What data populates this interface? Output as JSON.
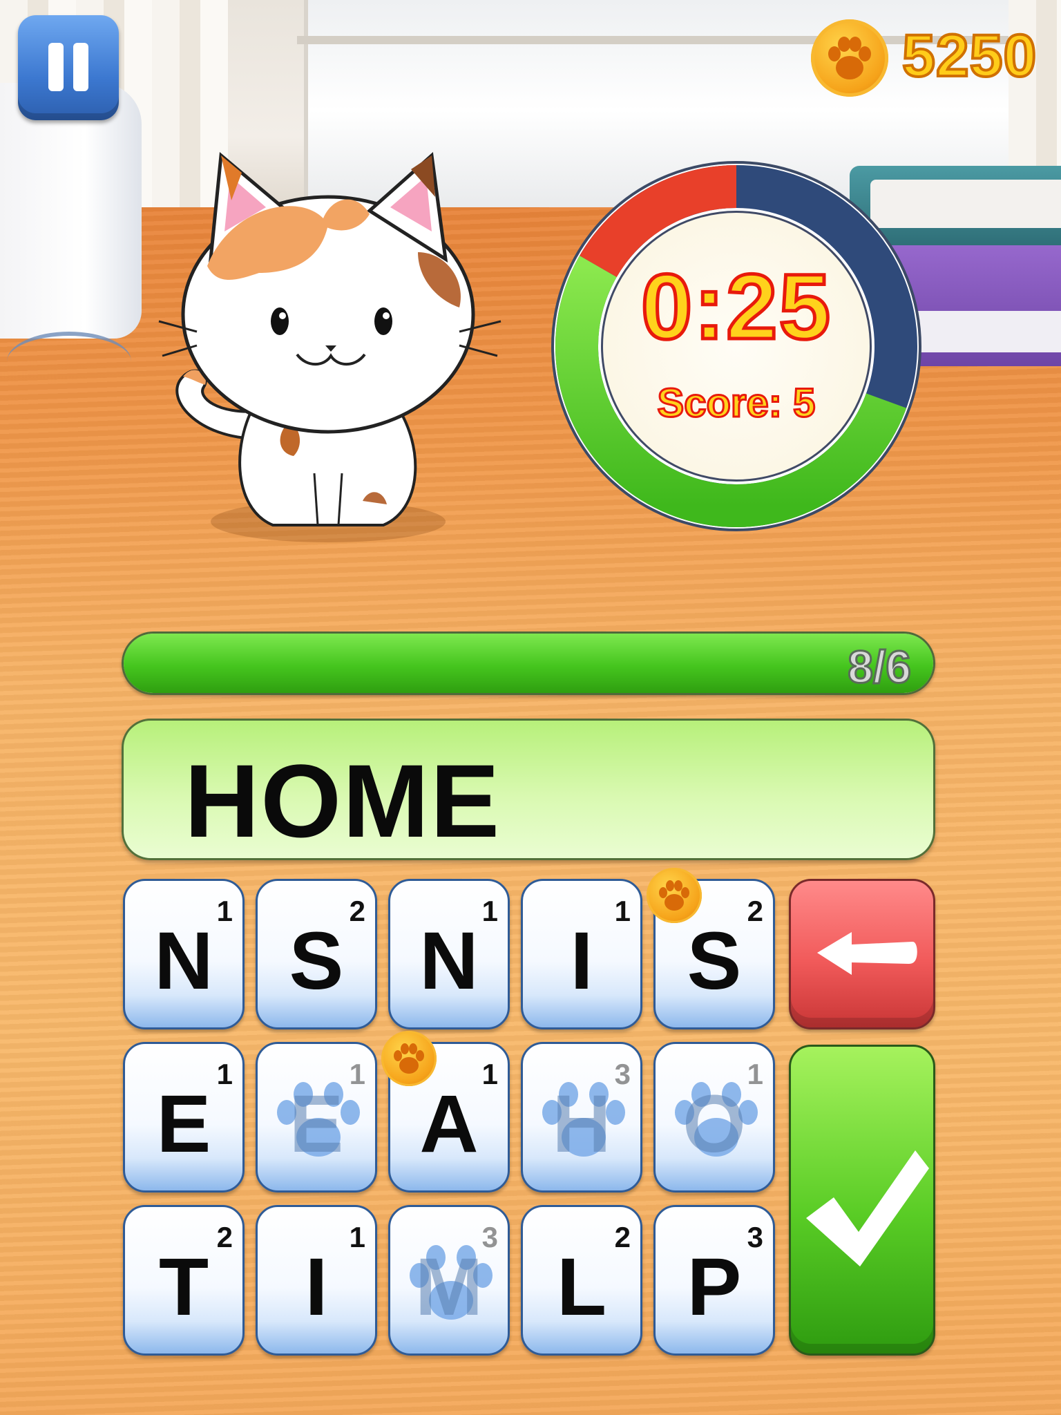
{
  "hud": {
    "coins": "5250",
    "pause_icon": "pause-icon",
    "coin_icon": "paw-coin-icon"
  },
  "timer": {
    "time": "0:25",
    "score": "Score: 5",
    "remaining_fraction": 0.58,
    "colors": {
      "remaining": "#56c82c",
      "elapsed_red": "#e8402a",
      "track": "#2f4a7a"
    }
  },
  "progress": {
    "label": "8/6",
    "fill_fraction": 1.0,
    "color": "#45c51e"
  },
  "word": {
    "current": "HOME"
  },
  "board": {
    "rows": [
      [
        {
          "letter": "N",
          "points": "1",
          "used": false,
          "bonus": false
        },
        {
          "letter": "S",
          "points": "2",
          "used": false,
          "bonus": false
        },
        {
          "letter": "N",
          "points": "1",
          "used": false,
          "bonus": false
        },
        {
          "letter": "I",
          "points": "1",
          "used": false,
          "bonus": false
        },
        {
          "letter": "S",
          "points": "2",
          "used": false,
          "bonus": true
        }
      ],
      [
        {
          "letter": "E",
          "points": "1",
          "used": false,
          "bonus": false
        },
        {
          "letter": "E",
          "points": "1",
          "used": true,
          "bonus": false
        },
        {
          "letter": "A",
          "points": "1",
          "used": false,
          "bonus": true
        },
        {
          "letter": "H",
          "points": "3",
          "used": true,
          "bonus": false
        },
        {
          "letter": "O",
          "points": "1",
          "used": true,
          "bonus": false
        }
      ],
      [
        {
          "letter": "T",
          "points": "2",
          "used": false,
          "bonus": false
        },
        {
          "letter": "I",
          "points": "1",
          "used": false,
          "bonus": false
        },
        {
          "letter": "M",
          "points": "3",
          "used": true,
          "bonus": false
        },
        {
          "letter": "L",
          "points": "2",
          "used": false,
          "bonus": false
        },
        {
          "letter": "P",
          "points": "3",
          "used": false,
          "bonus": false
        }
      ]
    ],
    "backspace_icon": "arrow-left-icon",
    "submit_icon": "checkmark-icon"
  },
  "colors": {
    "coin_gold": "#ffcc1a",
    "timer_text": "#ffd21c",
    "timer_outline": "#e81a0c",
    "tile_blue": "#8db8ec",
    "backspace_red": "#f15a5a",
    "submit_green": "#59cc25"
  }
}
